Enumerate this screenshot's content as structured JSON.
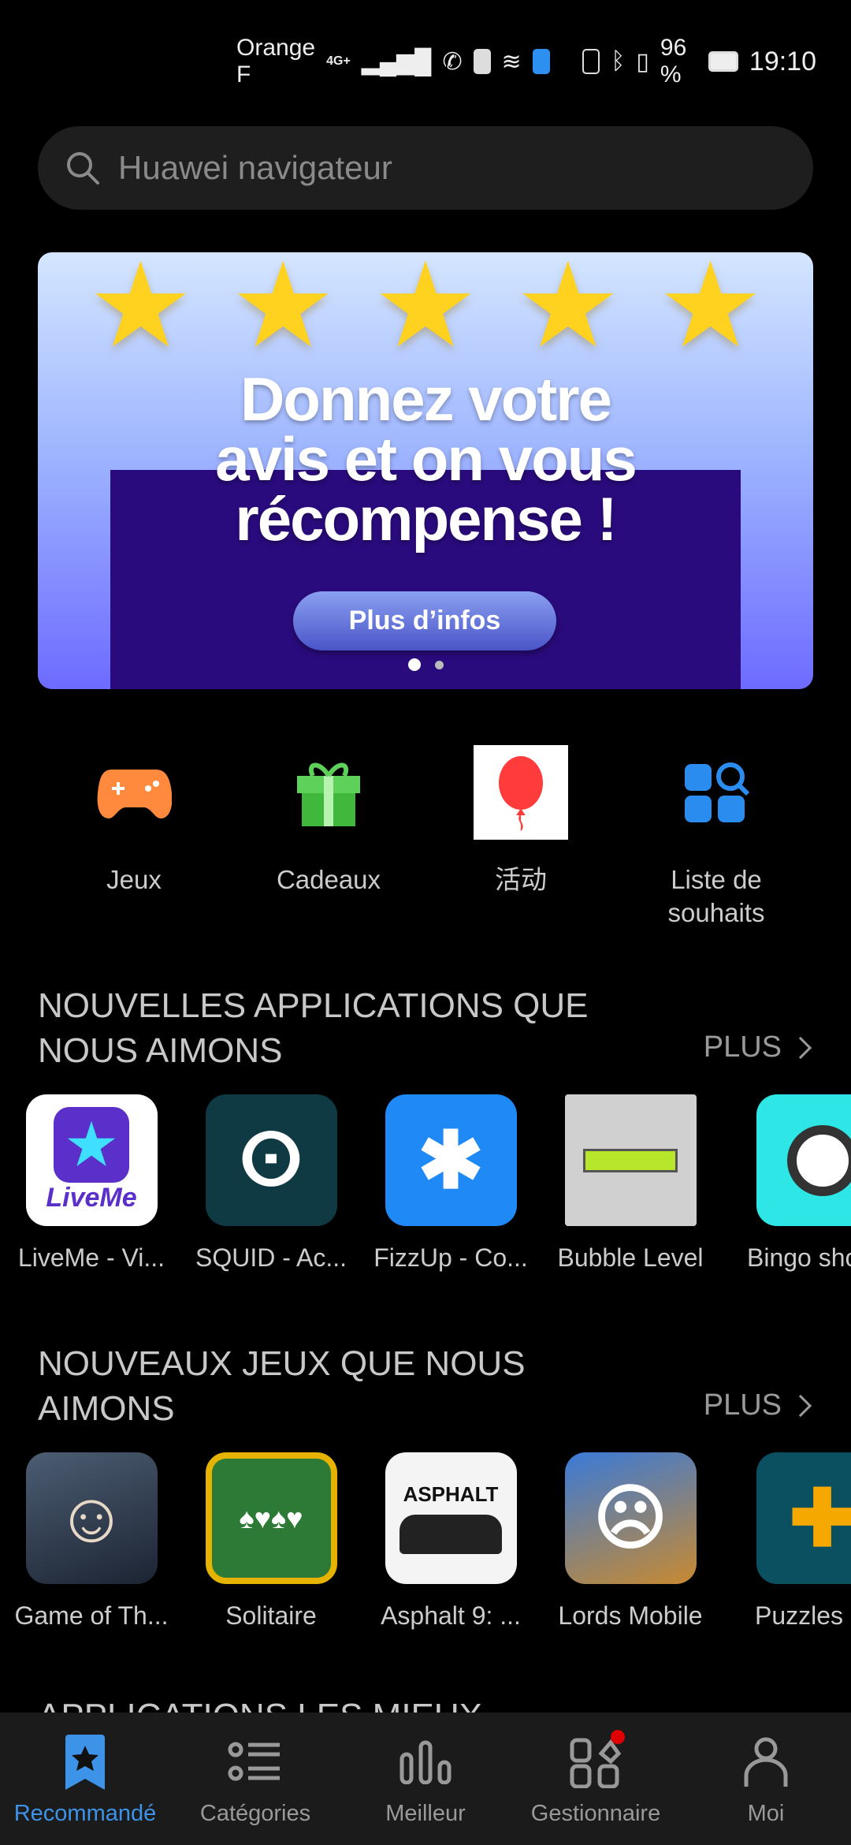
{
  "status_bar": {
    "carrier": "Orange F",
    "network": "4G+",
    "battery": "96 %",
    "time": "19:10"
  },
  "search": {
    "placeholder": "Huawei navigateur"
  },
  "banner": {
    "title_lines": [
      "Donnez votre",
      "avis et on vous",
      "récompense !"
    ],
    "button": "Plus d’infos",
    "page_count": 2,
    "active_page": 1,
    "star_count": 5
  },
  "quick_links": [
    {
      "label": "Jeux",
      "icon": "gamepad-icon"
    },
    {
      "label": "Cadeaux",
      "icon": "gift-icon"
    },
    {
      "label": "活动",
      "icon": "balloon-icon"
    },
    {
      "label": "Liste de souhaits",
      "icon": "wishlist-search-icon"
    }
  ],
  "sections": [
    {
      "title": "NOUVELLES APPLICATIONS QUE NOUS AIMONS",
      "more": "PLUS",
      "apps": [
        {
          "label": "LiveMe - Vi..."
        },
        {
          "label": "SQUID - Ac..."
        },
        {
          "label": "FizzUp - Co..."
        },
        {
          "label": "Bubble Level"
        },
        {
          "label": "Bingo sho"
        }
      ]
    },
    {
      "title": "NOUVEAUX JEUX QUE NOUS AIMONS",
      "more": "PLUS",
      "apps": [
        {
          "label": "Game of Th..."
        },
        {
          "label": "Solitaire"
        },
        {
          "label": "Asphalt 9: ..."
        },
        {
          "label": "Lords Mobile"
        },
        {
          "label": "Puzzles"
        }
      ]
    },
    {
      "title": "APPLICATIONS LES MIEUX"
    }
  ],
  "nav": [
    {
      "label": "Recommandé",
      "active": true
    },
    {
      "label": "Catégories"
    },
    {
      "label": "Meilleur"
    },
    {
      "label": "Gestionnaire",
      "badge": true
    },
    {
      "label": "Moi"
    }
  ],
  "colors": {
    "accent": "#3d93e8",
    "badge": "#e00000"
  }
}
